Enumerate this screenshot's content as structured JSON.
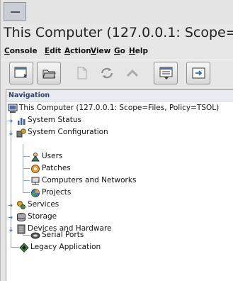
{
  "window": {
    "title": "This Computer (127.0.0.1: Scope="
  },
  "menu": [
    {
      "key": "C",
      "rest": "onsole"
    },
    {
      "key": "E",
      "rest": "dit"
    },
    {
      "key": "A",
      "rest": "ction"
    },
    {
      "key": "V",
      "rest": "iew"
    },
    {
      "key": "G",
      "rest": "o"
    },
    {
      "key": "H",
      "rest": "elp"
    }
  ],
  "toolbar": [
    {
      "icon": "new-window-icon"
    },
    {
      "icon": "open-folder-icon"
    },
    {
      "icon": "document-icon"
    },
    {
      "icon": "refresh-icon"
    },
    {
      "icon": "up-arrow-icon"
    },
    {
      "icon": "properties-icon"
    },
    {
      "icon": "export-icon"
    }
  ],
  "navigation": {
    "header": "Navigation",
    "root": "This Computer (127.0.0.1: Scope=Files, Policy=TSOL)",
    "items": {
      "system_status": "System Status",
      "system_configuration": "System Configuration",
      "users": "Users",
      "patches": "Patches",
      "computers_networks": "Computers and Networks",
      "projects": "Projects",
      "services": "Services",
      "storage": "Storage",
      "devices_hardware": "Devices and Hardware",
      "serial_ports": "Serial Ports",
      "legacy_application": "Legacy Application"
    }
  }
}
